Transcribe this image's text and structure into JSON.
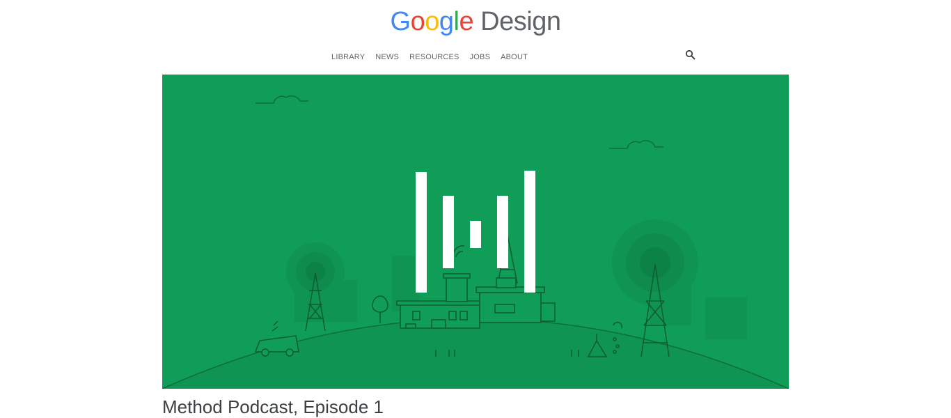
{
  "header": {
    "logo": {
      "word1": [
        "G",
        "o",
        "o",
        "g",
        "l",
        "e"
      ],
      "word2": "Design"
    },
    "nav": [
      "LIBRARY",
      "NEWS",
      "RESOURCES",
      "JOBS",
      "ABOUT"
    ],
    "search_icon": "search-icon"
  },
  "hero": {
    "background": "#109d58",
    "line_color": "#0d6e3a"
  },
  "article": {
    "title": "Method Podcast, Episode 1"
  }
}
